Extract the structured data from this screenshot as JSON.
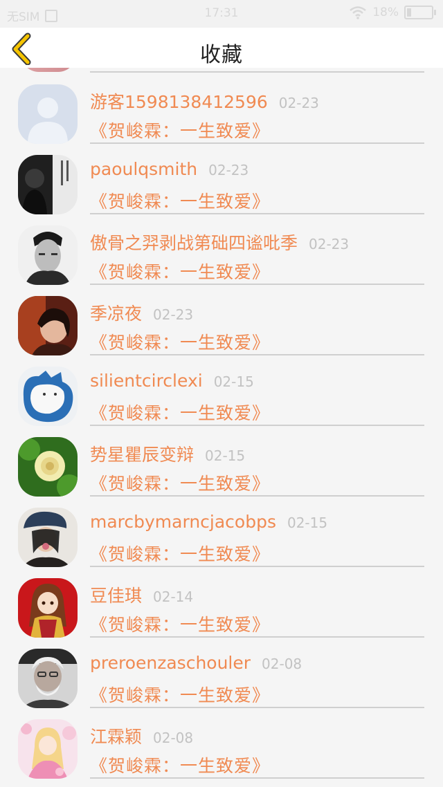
{
  "status_bar": {
    "carrier": "无SIM",
    "time": "17:31",
    "battery_text": "18%",
    "battery_level": 0.18
  },
  "header": {
    "title": "收藏",
    "back_icon": "chevron-left-icon",
    "accent": "#f5c400"
  },
  "favorites": [
    {
      "user": "游客1598138412596",
      "date": "02-23",
      "book": "《贺峻霖：一生致爱》"
    },
    {
      "user": "paoulqsmith",
      "date": "02-23",
      "book": "《贺峻霖：一生致爱》"
    },
    {
      "user": "傲骨之羿剥战第础四谧吡季",
      "date": "02-23",
      "book": "《贺峻霖：一生致爱》"
    },
    {
      "user": "季凉夜",
      "date": "02-23",
      "book": "《贺峻霖：一生致爱》"
    },
    {
      "user": "silientcirclexi",
      "date": "02-15",
      "book": "《贺峻霖：一生致爱》"
    },
    {
      "user": "势星瞿辰变辩",
      "date": "02-15",
      "book": "《贺峻霖：一生致爱》"
    },
    {
      "user": "marcbymarncjacobps",
      "date": "02-15",
      "book": "《贺峻霖：一生致爱》"
    },
    {
      "user": "豆佳琪",
      "date": "02-14",
      "book": "《贺峻霖：一生致爱》"
    },
    {
      "user": "preroenzaschouler",
      "date": "02-08",
      "book": "《贺峻霖：一生致爱》"
    },
    {
      "user": "江霖颖",
      "date": "02-08",
      "book": "《贺峻霖：一生致爱》"
    }
  ],
  "colors": {
    "name": "#f08a52",
    "date": "#c2c2c2",
    "divider": "#cfcfcf",
    "background": "#f5f5f5"
  }
}
